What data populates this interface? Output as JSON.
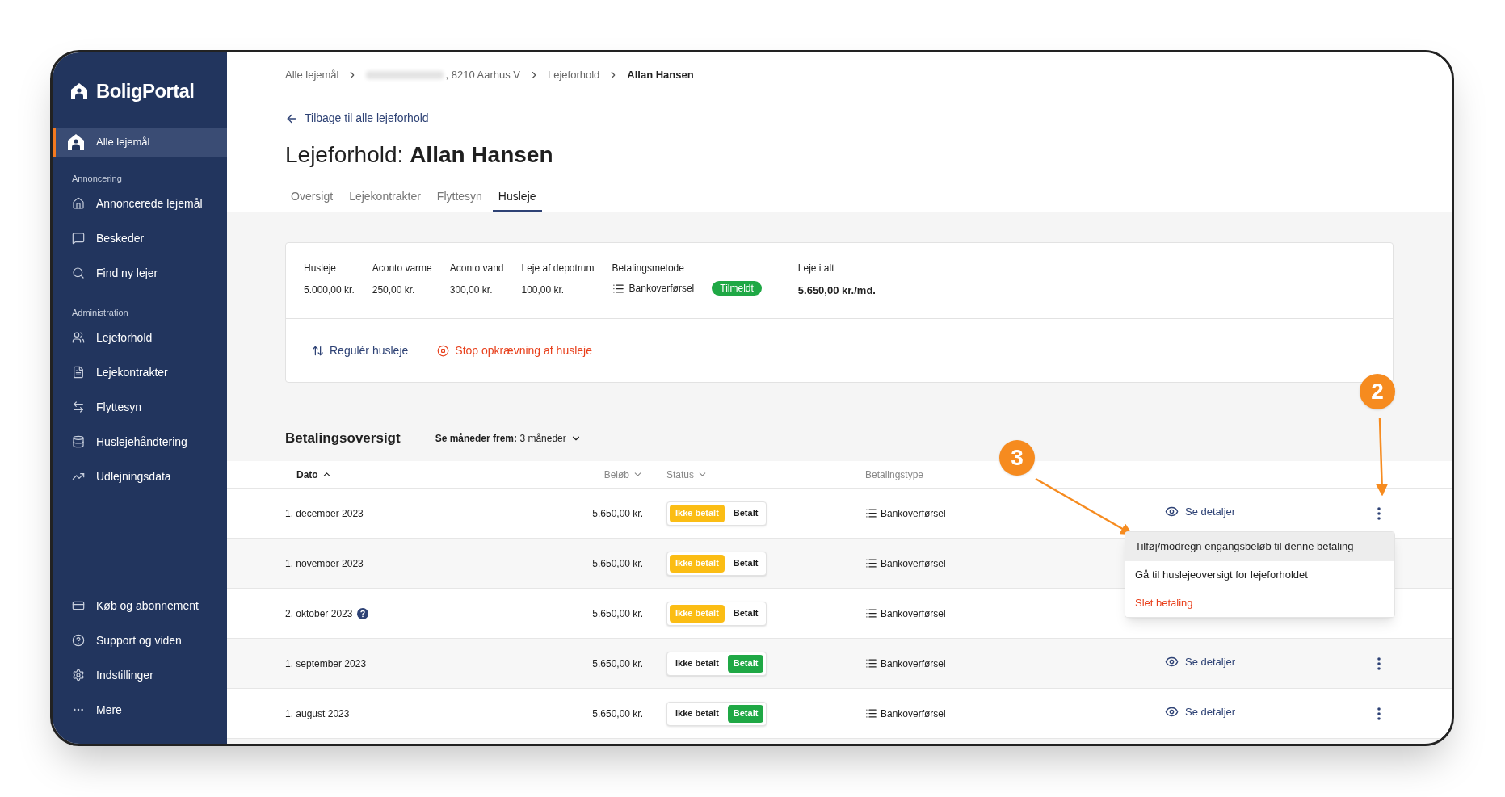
{
  "sidebar": {
    "logo": "BoligPortal",
    "top_item": {
      "label": "Alle lejemål",
      "selected": true
    },
    "sections": [
      {
        "title": "Annoncering",
        "items": [
          {
            "label": "Annoncerede lejemål",
            "selected": false
          },
          {
            "label": "Beskeder",
            "selected": false
          },
          {
            "label": "Find ny lejer",
            "selected": false
          }
        ]
      },
      {
        "title": "Administration",
        "items": [
          {
            "label": "Lejeforhold",
            "selected": false
          },
          {
            "label": "Lejekontrakter",
            "selected": false
          },
          {
            "label": "Flyttesyn",
            "selected": false
          },
          {
            "label": "Huslejehåndtering",
            "selected": false
          },
          {
            "label": "Udlejningsdata",
            "selected": false
          }
        ]
      }
    ],
    "bottom_items": [
      {
        "label": "Køb og abonnement",
        "selected": false
      },
      {
        "label": "Support og viden",
        "selected": false
      },
      {
        "label": "Indstillinger",
        "selected": false
      },
      {
        "label": "Mere",
        "selected": false
      }
    ]
  },
  "breadcrumb": [
    {
      "label": "Alle lejemål",
      "current": false,
      "redacted": false
    },
    {
      "label": ", 8210 Aarhus V",
      "current": false,
      "redacted": true
    },
    {
      "label": "Lejeforhold",
      "current": false,
      "redacted": false
    },
    {
      "label": "Allan Hansen",
      "current": true,
      "redacted": false
    }
  ],
  "back_link": "Tilbage til alle lejeforhold",
  "title": {
    "prefix": "Lejeforhold:",
    "name": "Allan Hansen"
  },
  "tabs": [
    {
      "label": "Oversigt",
      "selected": false
    },
    {
      "label": "Lejekontrakter",
      "selected": false
    },
    {
      "label": "Flyttesyn",
      "selected": false
    },
    {
      "label": "Husleje",
      "selected": true
    }
  ],
  "summary": {
    "fields": [
      {
        "label": "Husleje",
        "value": "5.000,00 kr."
      },
      {
        "label": "Aconto varme",
        "value": "250,00 kr."
      },
      {
        "label": "Aconto vand",
        "value": "300,00 kr."
      },
      {
        "label": "Leje af depotrum",
        "value": "100,00 kr."
      }
    ],
    "payment_method": {
      "label": "Betalingsmetode",
      "value": "Bankoverførsel",
      "badge": "Tilmeldt"
    },
    "total": {
      "label": "Leje i alt",
      "value": "5.650,00 kr./md."
    },
    "actions": [
      {
        "label": "Regulér husleje",
        "kind": "adjust"
      },
      {
        "label": "Stop opkrævning af husleje",
        "kind": "danger"
      }
    ]
  },
  "payments": {
    "heading": "Betalingsoversigt",
    "filter": {
      "label": "Se måneder frem:",
      "value": "3 måneder"
    },
    "columns": [
      {
        "label": "Dato",
        "sorted": true
      },
      {
        "label": "Beløb",
        "sorted": false
      },
      {
        "label": "Status",
        "sorted": false
      },
      {
        "label": "Betalingstype",
        "sorted": false
      }
    ],
    "rows": [
      {
        "date": "1. december 2023",
        "help_icon": false,
        "amount": "5.650,00 kr.",
        "status": [
          {
            "label": "Ikke betalt",
            "selected": true
          },
          {
            "label": "Betalt",
            "selected": false
          }
        ],
        "type": "Bankoverførsel",
        "details": "Se detaljer"
      },
      {
        "date": "1. november 2023",
        "help_icon": false,
        "amount": "5.650,00 kr.",
        "status": [
          {
            "label": "Ikke betalt",
            "selected": true
          },
          {
            "label": "Betalt",
            "selected": false
          }
        ],
        "type": "Bankoverførsel",
        "more_button": false
      },
      {
        "date": "2. oktober 2023",
        "help_icon": true,
        "amount": "5.650,00 kr.",
        "status": [
          {
            "label": "Ikke betalt",
            "selected": true
          },
          {
            "label": "Betalt",
            "selected": false
          }
        ],
        "type": "Bankoverførsel",
        "more_button": false
      },
      {
        "date": "1. september 2023",
        "help_icon": false,
        "amount": "5.650,00 kr.",
        "status": [
          {
            "label": "Ikke betalt",
            "selected": false
          },
          {
            "label": "Betalt",
            "selected": true
          }
        ],
        "type": "Bankoverførsel",
        "details": "Se detaljer"
      },
      {
        "date": "1. august 2023",
        "help_icon": false,
        "amount": "5.650,00 kr.",
        "status": [
          {
            "label": "Ikke betalt",
            "selected": false
          },
          {
            "label": "Betalt",
            "selected": true
          }
        ],
        "type": "Bankoverførsel",
        "details": "Se detaljer"
      }
    ],
    "menu": [
      {
        "label": "Tilføj/modregn engangsbeløb til denne betaling",
        "kind": "normal",
        "highlighted": true
      },
      {
        "label": "Gå til huslejeoversigt for lejeforholdet",
        "kind": "normal",
        "highlighted": false
      },
      {
        "label": "Slet betaling",
        "kind": "danger",
        "highlighted": false
      }
    ]
  },
  "annotations": [
    {
      "label": "2"
    },
    {
      "label": "3"
    }
  ]
}
